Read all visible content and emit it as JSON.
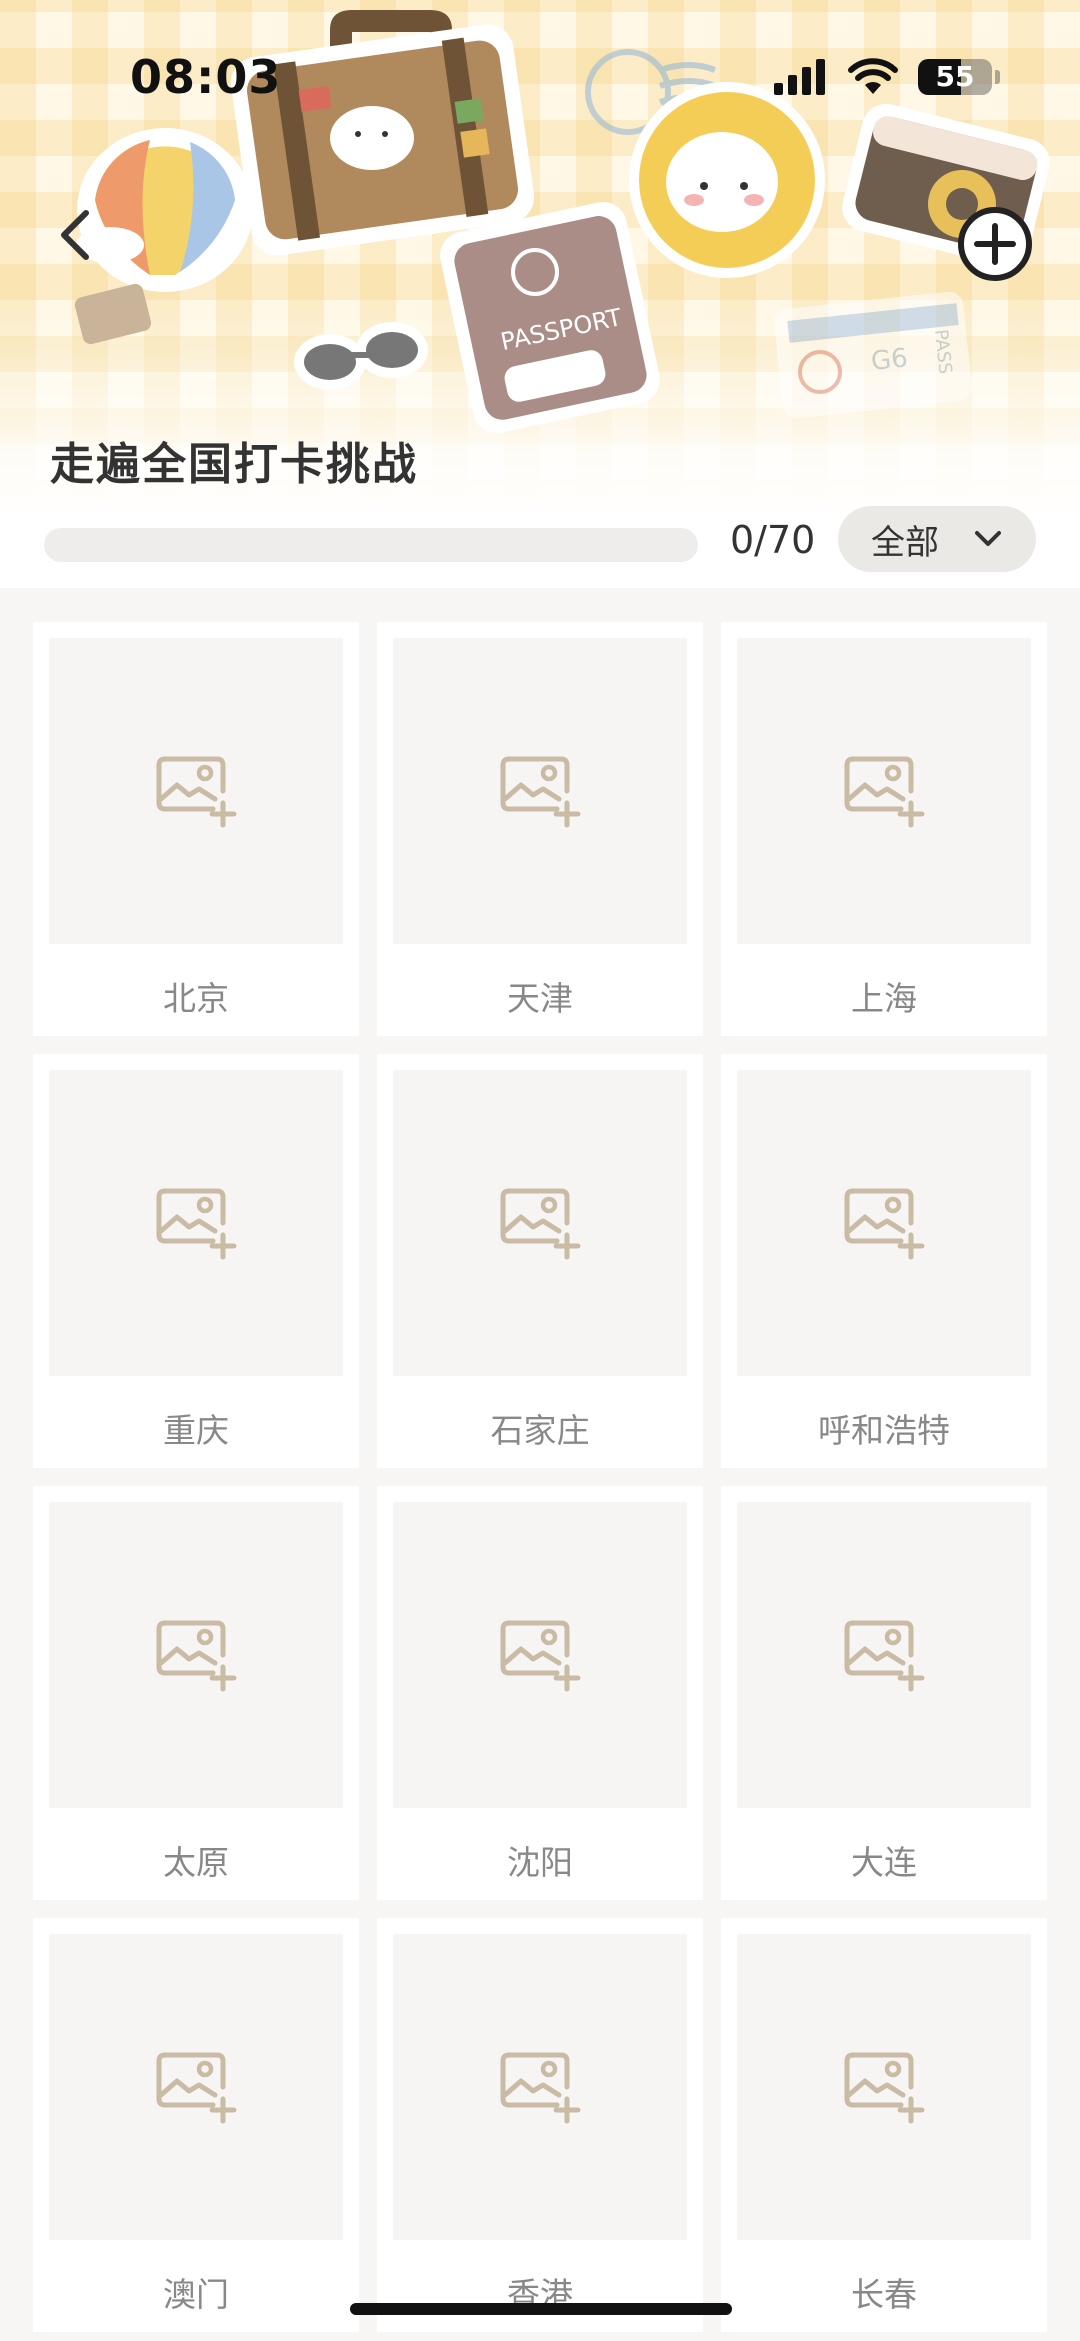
{
  "status_bar": {
    "time": "08:03",
    "battery": "55",
    "battery_level_percent": 55,
    "icons": [
      "cellular-signal-icon",
      "wifi-icon",
      "battery-icon"
    ]
  },
  "header": {
    "title": "走遍全国打卡挑战",
    "back_icon": "chevron-left-icon",
    "add_icon": "plus-circle-icon",
    "illustration": "travel-sticker-banner",
    "illustration_text": {
      "passport": "PASSPORT",
      "ticket": "G6",
      "ticket_pass": "PASS"
    }
  },
  "progress": {
    "text": "0/70",
    "completed": 0,
    "total": 70
  },
  "filter": {
    "selected": "全部",
    "icon": "chevron-down-icon"
  },
  "cities": [
    {
      "name": "北京"
    },
    {
      "name": "天津"
    },
    {
      "name": "上海"
    },
    {
      "name": "重庆"
    },
    {
      "name": "石家庄"
    },
    {
      "name": "呼和浩特"
    },
    {
      "name": "太原"
    },
    {
      "name": "沈阳"
    },
    {
      "name": "大连"
    },
    {
      "name": "澳门"
    },
    {
      "name": "香港"
    },
    {
      "name": "长春"
    }
  ],
  "card_icon": "add-photo-icon",
  "colors": {
    "accent": "#e5c98e",
    "background": "#f7f6f4",
    "card": "#ffffff",
    "placeholder": "#f6f5f3",
    "icon": "#c9bba4"
  }
}
